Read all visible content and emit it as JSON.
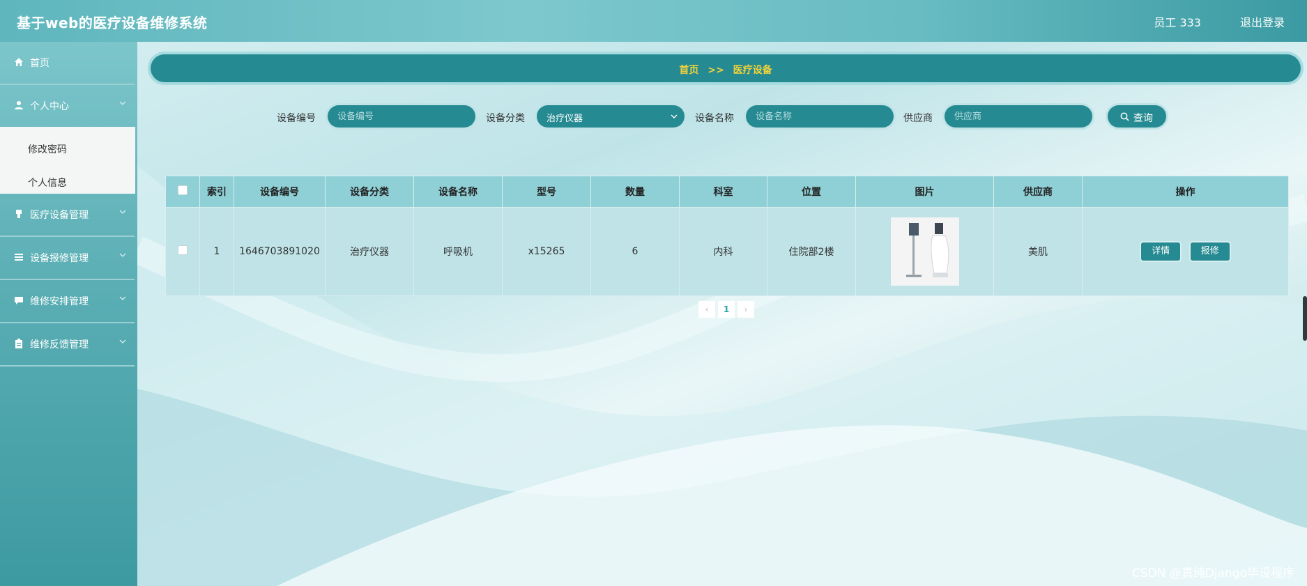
{
  "header": {
    "title": "基于web的医疗设备维修系统",
    "user": "员工 333",
    "logout": "退出登录"
  },
  "sidebar": {
    "items": [
      {
        "label": "首页",
        "icon": "home-icon"
      },
      {
        "label": "个人中心",
        "icon": "user-icon"
      },
      {
        "label": "医疗设备管理",
        "icon": "equipment-icon"
      },
      {
        "label": "设备报修管理",
        "icon": "list-icon"
      },
      {
        "label": "维修安排管理",
        "icon": "comment-icon"
      },
      {
        "label": "维修反馈管理",
        "icon": "clipboard-icon"
      }
    ],
    "submenu": [
      "修改密码",
      "个人信息"
    ]
  },
  "breadcrumb": {
    "home": "首页",
    "sep": ">>",
    "current": "医疗设备"
  },
  "search": {
    "code_label": "设备编号",
    "code_placeholder": "设备编号",
    "category_label": "设备分类",
    "category_value": "治疗仪器",
    "name_label": "设备名称",
    "name_placeholder": "设备名称",
    "supplier_label": "供应商",
    "supplier_placeholder": "供应商",
    "query_button": "查询"
  },
  "table": {
    "headers": [
      "索引",
      "设备编号",
      "设备分类",
      "设备名称",
      "型号",
      "数量",
      "科室",
      "位置",
      "图片",
      "供应商",
      "操作"
    ],
    "rows": [
      {
        "index": "1",
        "code": "1646703891020",
        "category": "治疗仪器",
        "name": "呼吸机",
        "model": "x15265",
        "quantity": "6",
        "department": "内科",
        "location": "住院部2楼",
        "supplier": "美肌",
        "detail_button": "详情",
        "repair_button": "报修"
      }
    ]
  },
  "pagination": {
    "current": "1",
    "prev": "‹",
    "next": "›"
  },
  "watermark": "CSDN @真纯Django毕设程序",
  "colors": {
    "accent": "#258a91",
    "breadcrumb_text": "#f3d23b",
    "table_header": "#8fd0d6"
  }
}
